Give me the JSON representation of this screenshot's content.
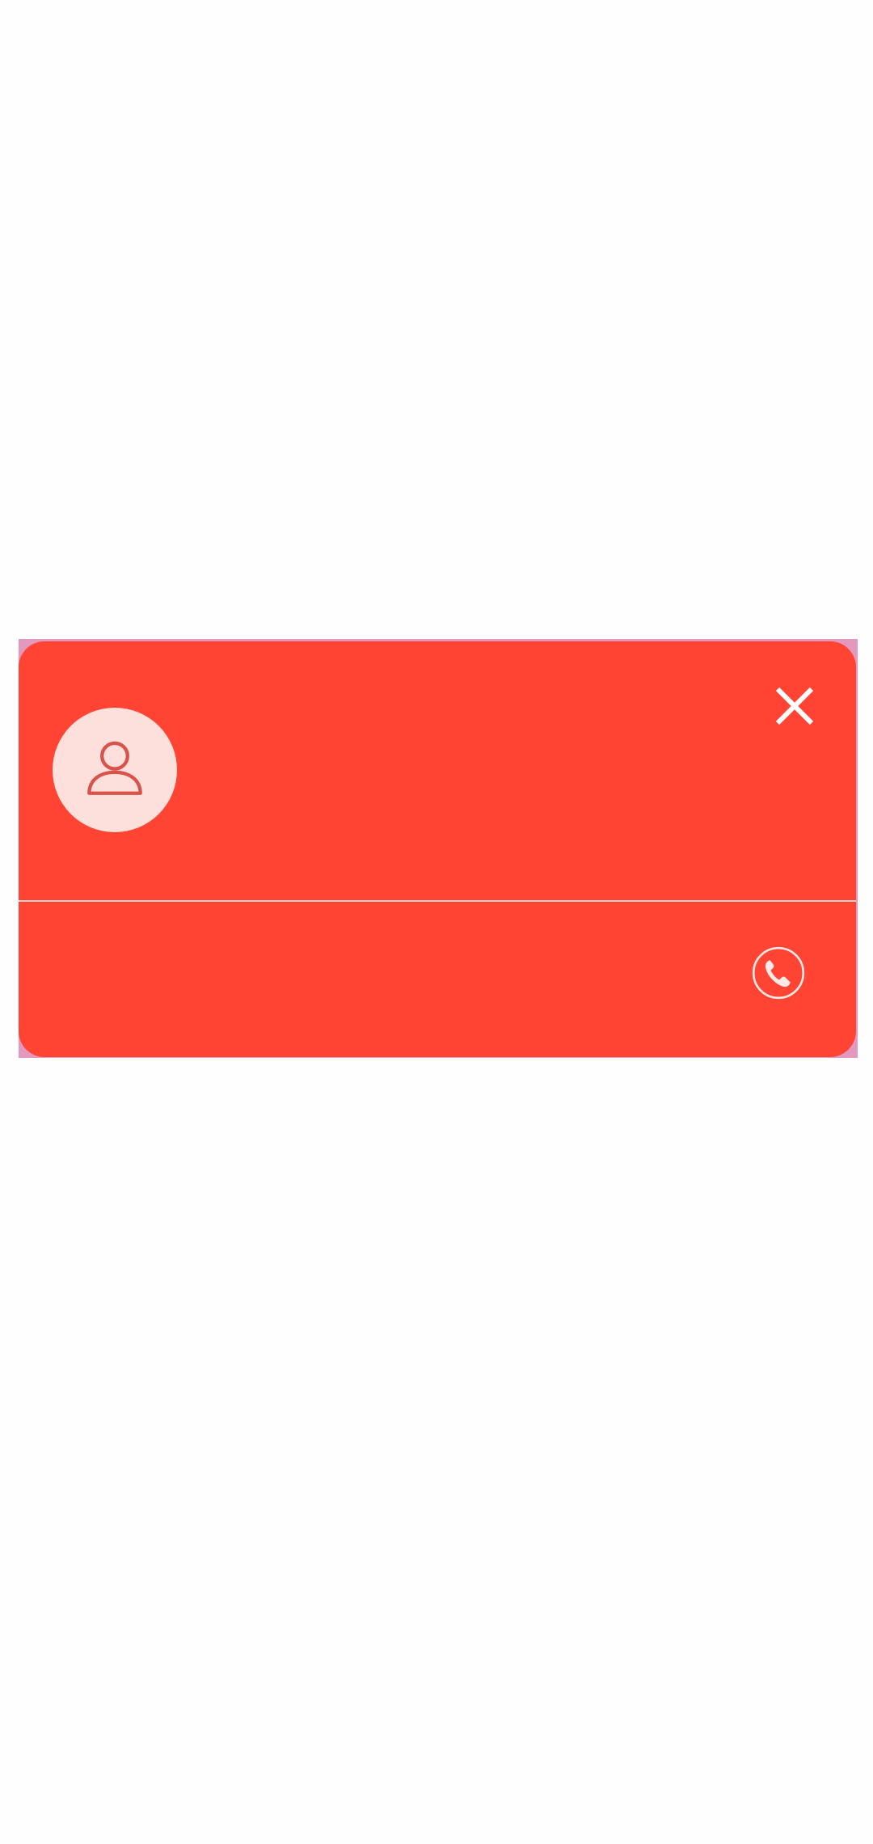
{
  "dialog": {
    "avatar_icon": "person-icon",
    "close_icon": "close-icon",
    "call_icon": "phone-icon"
  },
  "colors": {
    "card_background": "#ff4433",
    "backdrop": "#e398bd",
    "avatar_background": "#fde0dc",
    "avatar_stroke": "#d9534a",
    "page_background": "#fefefe"
  }
}
